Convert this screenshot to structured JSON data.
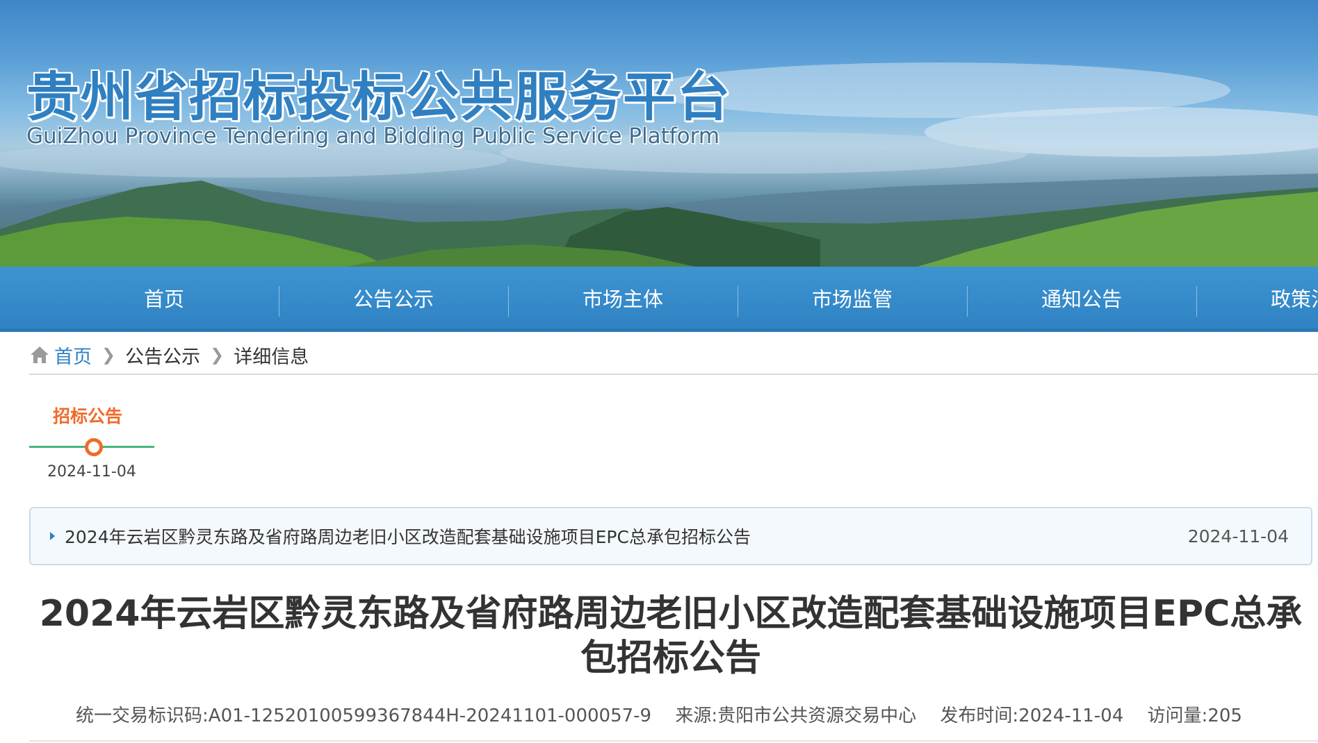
{
  "header": {
    "title_cn": "贵州省招标投标公共服务平台",
    "title_en": "GuiZhou Province Tendering and Bidding Public Service Platform"
  },
  "nav": {
    "items": [
      {
        "label": "首页"
      },
      {
        "label": "公告公示"
      },
      {
        "label": "市场主体"
      },
      {
        "label": "市场监管"
      },
      {
        "label": "通知公告"
      },
      {
        "label": "政策法规"
      }
    ]
  },
  "breadcrumb": {
    "icon": "home-icon",
    "items": [
      "首页",
      "公告公示",
      "详细信息"
    ]
  },
  "timeline": {
    "label": "招标公告",
    "date": "2024-11-04"
  },
  "notice": {
    "title": "2024年云岩区黔灵东路及省府路周边老旧小区改造配套基础设施项目EPC总承包招标公告",
    "date": "2024-11-04"
  },
  "article": {
    "title": "2024年云岩区黔灵东路及省府路周边老旧小区改造配套基础设施项目EPC总承包招标公告",
    "meta": {
      "trade_id": "统一交易标识码:A01-12520100599367844H-20241101-000057-9",
      "source": "来源:贵阳市公共资源交易中心",
      "publish_time": "发布时间:2024-11-04",
      "visits": "访问量:205"
    }
  },
  "colors": {
    "nav_bg": "#2f83c4",
    "accent_orange": "#f06a2a",
    "timeline_green": "#45b57c",
    "link_blue": "#2f7fc1"
  }
}
